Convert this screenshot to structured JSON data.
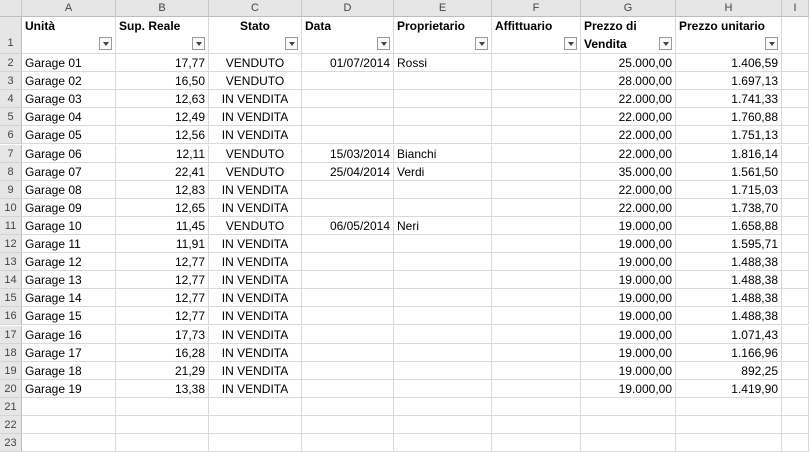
{
  "columns": [
    "A",
    "B",
    "C",
    "D",
    "E",
    "F",
    "G",
    "H",
    "I"
  ],
  "header": {
    "A": "Unità",
    "B": "Sup. Reale",
    "C": "Stato",
    "D": "Data",
    "E": "Proprietario",
    "F": "Affittuario",
    "G1": "Prezzo di",
    "G2": "Vendita",
    "H": "Prezzo unitario"
  },
  "rows": [
    {
      "n": "2",
      "unit": "Garage 01",
      "sup": "17,77",
      "stato": "VENDUTO",
      "data": "01/07/2014",
      "prop": "Rossi",
      "aff": "",
      "prezzo": "25.000,00",
      "unit_price": "1.406,59"
    },
    {
      "n": "3",
      "unit": "Garage 02",
      "sup": "16,50",
      "stato": "VENDUTO",
      "data": "",
      "prop": "",
      "aff": "",
      "prezzo": "28.000,00",
      "unit_price": "1.697,13"
    },
    {
      "n": "4",
      "unit": "Garage 03",
      "sup": "12,63",
      "stato": "IN VENDITA",
      "data": "",
      "prop": "",
      "aff": "",
      "prezzo": "22.000,00",
      "unit_price": "1.741,33"
    },
    {
      "n": "5",
      "unit": "Garage 04",
      "sup": "12,49",
      "stato": "IN VENDITA",
      "data": "",
      "prop": "",
      "aff": "",
      "prezzo": "22.000,00",
      "unit_price": "1.760,88"
    },
    {
      "n": "6",
      "unit": "Garage 05",
      "sup": "12,56",
      "stato": "IN VENDITA",
      "data": "",
      "prop": "",
      "aff": "",
      "prezzo": "22.000,00",
      "unit_price": "1.751,13"
    },
    {
      "n": "7",
      "unit": "Garage 06",
      "sup": "12,11",
      "stato": "VENDUTO",
      "data": "15/03/2014",
      "prop": "Bianchi",
      "aff": "",
      "prezzo": "22.000,00",
      "unit_price": "1.816,14"
    },
    {
      "n": "8",
      "unit": "Garage 07",
      "sup": "22,41",
      "stato": "VENDUTO",
      "data": "25/04/2014",
      "prop": "Verdi",
      "aff": "",
      "prezzo": "35.000,00",
      "unit_price": "1.561,50"
    },
    {
      "n": "9",
      "unit": "Garage 08",
      "sup": "12,83",
      "stato": "IN VENDITA",
      "data": "",
      "prop": "",
      "aff": "",
      "prezzo": "22.000,00",
      "unit_price": "1.715,03"
    },
    {
      "n": "10",
      "unit": "Garage 09",
      "sup": "12,65",
      "stato": "IN VENDITA",
      "data": "",
      "prop": "",
      "aff": "",
      "prezzo": "22.000,00",
      "unit_price": "1.738,70"
    },
    {
      "n": "11",
      "unit": "Garage 10",
      "sup": "11,45",
      "stato": "VENDUTO",
      "data": "06/05/2014",
      "prop": "Neri",
      "aff": "",
      "prezzo": "19.000,00",
      "unit_price": "1.658,88"
    },
    {
      "n": "12",
      "unit": "Garage 11",
      "sup": "11,91",
      "stato": "IN VENDITA",
      "data": "",
      "prop": "",
      "aff": "",
      "prezzo": "19.000,00",
      "unit_price": "1.595,71"
    },
    {
      "n": "13",
      "unit": "Garage 12",
      "sup": "12,77",
      "stato": "IN VENDITA",
      "data": "",
      "prop": "",
      "aff": "",
      "prezzo": "19.000,00",
      "unit_price": "1.488,38"
    },
    {
      "n": "14",
      "unit": "Garage 13",
      "sup": "12,77",
      "stato": "IN VENDITA",
      "data": "",
      "prop": "",
      "aff": "",
      "prezzo": "19.000,00",
      "unit_price": "1.488,38"
    },
    {
      "n": "15",
      "unit": "Garage 14",
      "sup": "12,77",
      "stato": "IN VENDITA",
      "data": "",
      "prop": "",
      "aff": "",
      "prezzo": "19.000,00",
      "unit_price": "1.488,38"
    },
    {
      "n": "16",
      "unit": "Garage 15",
      "sup": "12,77",
      "stato": "IN VENDITA",
      "data": "",
      "prop": "",
      "aff": "",
      "prezzo": "19.000,00",
      "unit_price": "1.488,38"
    },
    {
      "n": "17",
      "unit": "Garage 16",
      "sup": "17,73",
      "stato": "IN VENDITA",
      "data": "",
      "prop": "",
      "aff": "",
      "prezzo": "19.000,00",
      "unit_price": "1.071,43"
    },
    {
      "n": "18",
      "unit": "Garage 17",
      "sup": "16,28",
      "stato": "IN VENDITA",
      "data": "",
      "prop": "",
      "aff": "",
      "prezzo": "19.000,00",
      "unit_price": "1.166,96"
    },
    {
      "n": "19",
      "unit": "Garage 18",
      "sup": "21,29",
      "stato": "IN VENDITA",
      "data": "",
      "prop": "",
      "aff": "",
      "prezzo": "19.000,00",
      "unit_price": "892,25"
    },
    {
      "n": "20",
      "unit": "Garage 19",
      "sup": "13,38",
      "stato": "IN VENDITA",
      "data": "",
      "prop": "",
      "aff": "",
      "prezzo": "19.000,00",
      "unit_price": "1.419,90"
    }
  ],
  "empty_rows": [
    "21",
    "22",
    "23"
  ],
  "header_row_number": "1"
}
